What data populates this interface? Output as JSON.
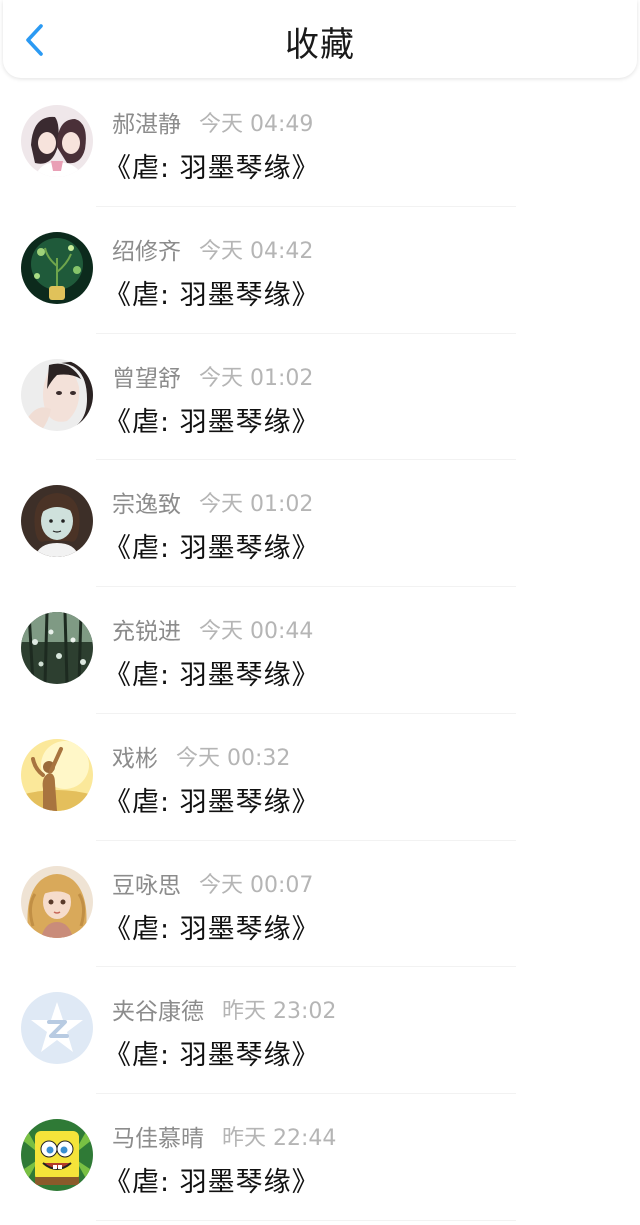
{
  "header": {
    "title": "收藏",
    "back_icon": "chevron-left-icon",
    "accent_color": "#2b9af3"
  },
  "items": [
    {
      "name": "郝湛静",
      "time": "今天 04:49",
      "book": "《虐: 羽墨琴缘》",
      "avatar": "anime-couple-avatar"
    },
    {
      "name": "绍修齐",
      "time": "今天 04:42",
      "book": "《虐: 羽墨琴缘》",
      "avatar": "green-plant-avatar"
    },
    {
      "name": "曾望舒",
      "time": "今天 01:02",
      "book": "《虐: 羽墨琴缘》",
      "avatar": "girl-portrait-avatar"
    },
    {
      "name": "宗逸致",
      "time": "今天 01:02",
      "book": "《虐: 羽墨琴缘》",
      "avatar": "cartoon-woman-avatar"
    },
    {
      "name": "充锐进",
      "time": "今天 00:44",
      "book": "《虐: 羽墨琴缘》",
      "avatar": "crystal-tree-avatar"
    },
    {
      "name": "戏彬",
      "time": "今天 00:32",
      "book": "《虐: 羽墨琴缘》",
      "avatar": "sunset-silhouette-avatar"
    },
    {
      "name": "豆咏思",
      "time": "今天 00:07",
      "book": "《虐: 羽墨琴缘》",
      "avatar": "blonde-girl-avatar"
    },
    {
      "name": "夹谷康德",
      "time": "昨天 23:02",
      "book": "《虐: 羽墨琴缘》",
      "avatar": "default-z-avatar"
    },
    {
      "name": "马佳慕晴",
      "time": "昨天 22:44",
      "book": "《虐: 羽墨琴缘》",
      "avatar": "spongebob-avatar"
    }
  ]
}
